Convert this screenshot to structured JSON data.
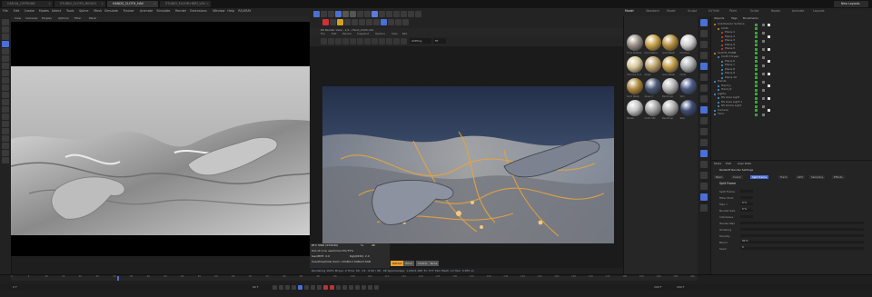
{
  "tabs": [
    {
      "label": "CAR-VA_OFFROAD",
      "active": false
    },
    {
      "label": "STUDIO_CLOTH_RIGV01",
      "active": false
    },
    {
      "label": "HANDS_CLOTH_HAV",
      "active": true
    },
    {
      "label": "STUDIO_FLOOR-HDRI_V01",
      "active": false
    }
  ],
  "menu": [
    "File",
    "Edit",
    "Create",
    "Modes",
    "Select",
    "Tools",
    "Spline",
    "Mesh",
    "Simulate",
    "Tracker",
    "Animate",
    "Simulate",
    "Render",
    "Extensions",
    "Window",
    "Help",
    "RS/VRAY"
  ],
  "layouts": [
    "Model",
    "Standard",
    "Model",
    "Sculpt",
    "UV Edit",
    "Paint",
    "Script",
    "Nodes",
    "Animate",
    "Layouts"
  ],
  "new_layouts_label": "New Layouts",
  "viewport1": {
    "menu": [
      "View",
      "Cameras",
      "Display",
      "Options",
      "Filter",
      "Panel"
    ]
  },
  "render_view": {
    "title": "RS Render View - 1/1 - Hand_Cloth.c4d",
    "menu": [
      "File",
      "Edit",
      "Render",
      "Snapshot",
      "Options",
      "View",
      "Bkd"
    ],
    "colorspace": "ACEScg",
    "zoom": "Fit",
    "stats": {
      "gpu_line": "RTX 3090 (STUDIO)",
      "gpu_pct": "%:",
      "gpu_val": "98",
      "line2": "Out-of-core used/max:0%/75%",
      "line3": "Geo/BVH:   2.0",
      "line3b": "Rgb(DDR):  2.0",
      "line4": "Used/free/total diam: 12GB/12.0GB/24.0GB",
      "badges": [
        "Refresh",
        "Other",
        "Control",
        "None"
      ]
    },
    "status": "Rendering   100%   Mrays: 0   Time: 00 : 01 : 6.00 / 08 : 48   Spp/maxspp: 1,000/1,000   Tri: 377.79m   Mesh: 12   Hair: 0   RTX on"
  },
  "materials": [
    {
      "name": "Floor Rubber",
      "color": "#9a8f86"
    },
    {
      "name": "Gold Metal",
      "color": "#c8a24a"
    },
    {
      "name": "Gold Metal",
      "color": "#b89040"
    },
    {
      "name": "Chrome",
      "color": "#cfcfcf"
    },
    {
      "name": "Chrome Tint",
      "color": "#d8c89a"
    },
    {
      "name": "Glass",
      "color": "#bfa36b"
    },
    {
      "name": "Gold Metal",
      "color": "#c4a04c"
    },
    {
      "name": "Cloth",
      "color": "#aeb1b4"
    },
    {
      "name": "Gold Metal",
      "color": "#b08b3e"
    },
    {
      "name": "Glass 2",
      "color": "#4b5876"
    },
    {
      "name": "Backdrop",
      "color": "#b7b7b7"
    },
    {
      "name": "Skin",
      "color": "#4a5b86"
    },
    {
      "name": "Sheen",
      "color": "#c4c4c4"
    },
    {
      "name": "Cloth Silk",
      "color": "#a5a5a5"
    },
    {
      "name": "Backdrop",
      "color": "#b0b0b0"
    },
    {
      "name": "Skin",
      "color": "#3e4c74"
    }
  ],
  "object_manager": {
    "menu": [
      "Objects",
      "Tags",
      "Bookmarks"
    ],
    "rows": [
      {
        "name": "Subdivision Surface",
        "indent": 0,
        "color": "#e08a2a"
      },
      {
        "name": "Cloth",
        "indent": 1,
        "color": "#e08a2a"
      },
      {
        "name": "Plane.1",
        "indent": 2,
        "color": "#d0482a"
      },
      {
        "name": "Plane.2",
        "indent": 2,
        "color": "#d0482a"
      },
      {
        "name": "Plane.3",
        "indent": 2,
        "color": "#d0482a"
      },
      {
        "name": "Plane.4",
        "indent": 2,
        "color": "#d0482a"
      },
      {
        "name": "Plane.5",
        "indent": 2,
        "color": "#d0482a"
      },
      {
        "name": "CLOTH_FORM",
        "indent": 0,
        "color": "#e08a2a"
      },
      {
        "name": "Cloth.Thread",
        "indent": 1,
        "color": "#4a9ad6"
      },
      {
        "name": "Plane.6",
        "indent": 2,
        "color": "#4a9ad6"
      },
      {
        "name": "Plane.7",
        "indent": 2,
        "color": "#4a9ad6"
      },
      {
        "name": "Plane.8",
        "indent": 2,
        "color": "#4a9ad6"
      },
      {
        "name": "Plane.9",
        "indent": 2,
        "color": "#4a9ad6"
      },
      {
        "name": "Plane.10",
        "indent": 2,
        "color": "#4a9ad6"
      },
      {
        "name": "Hands",
        "indent": 0,
        "color": "#4a9ad6"
      },
      {
        "name": "Hand_L",
        "indent": 1,
        "color": "#4a9ad6"
      },
      {
        "name": "Hand_R",
        "indent": 1,
        "color": "#4a9ad6"
      },
      {
        "name": "Lights",
        "indent": 0,
        "color": "#4a9ad6"
      },
      {
        "name": "RS Area Light",
        "indent": 1,
        "color": "#4a9ad6"
      },
      {
        "name": "RS Area Light.1",
        "indent": 1,
        "color": "#4a9ad6"
      },
      {
        "name": "RS Dome Light",
        "indent": 1,
        "color": "#4a9ad6"
      },
      {
        "name": "Camera",
        "indent": 0,
        "color": "#4a9ad6"
      },
      {
        "name": "Floor",
        "indent": 0,
        "color": "#4a9ad6"
      }
    ]
  },
  "attributes": {
    "menu": [
      "Mode",
      "Edit",
      "User Data"
    ],
    "object_title": "Redshift Render Settings",
    "tabs": [
      "Basic",
      "Coord.",
      "Split Frame",
      "Track",
      "GPU",
      "Sampling",
      "Effects"
    ],
    "active_tab": "Split Frame",
    "section": "Split Frame",
    "fields": [
      {
        "label": "Split Frame",
        "value": ""
      },
      {
        "label": "Filter Mult.",
        "value": ""
      },
      {
        "label": "Max Y",
        "value": "0 %"
      },
      {
        "label": "Bucket Size",
        "value": "0 %"
      },
      {
        "label": "Interleave",
        "value": ""
      },
      {
        "label": "Iterate Max",
        "value": ""
      },
      {
        "label": "Ordering",
        "value": ""
      },
      {
        "label": "Density",
        "value": ""
      },
      {
        "label": "Blend",
        "value": "50 %"
      },
      {
        "label": "Seed",
        "value": "0"
      }
    ]
  },
  "timeline": {
    "ticks": [
      "0",
      "5",
      "10",
      "15",
      "20",
      "25",
      "30",
      "35",
      "40",
      "45",
      "50",
      "55",
      "60",
      "65",
      "70",
      "75",
      "80",
      "85",
      "90",
      "95",
      "100",
      "105",
      "110",
      "115",
      "120",
      "125",
      "130",
      "135",
      "140",
      "145",
      "150",
      "155",
      "160",
      "165",
      "170",
      "175",
      "180",
      "185",
      "190",
      "195",
      "200"
    ],
    "start_frame": "0 F",
    "current_frame": "60 F",
    "end_frame": "200 F",
    "end_frame2": "200 F",
    "playhead_fraction": 0.155
  },
  "colors": {
    "accent_blue": "#4a6fd6",
    "render_stats_highlight": "#e8a030",
    "check_green": "#3aa13a"
  }
}
